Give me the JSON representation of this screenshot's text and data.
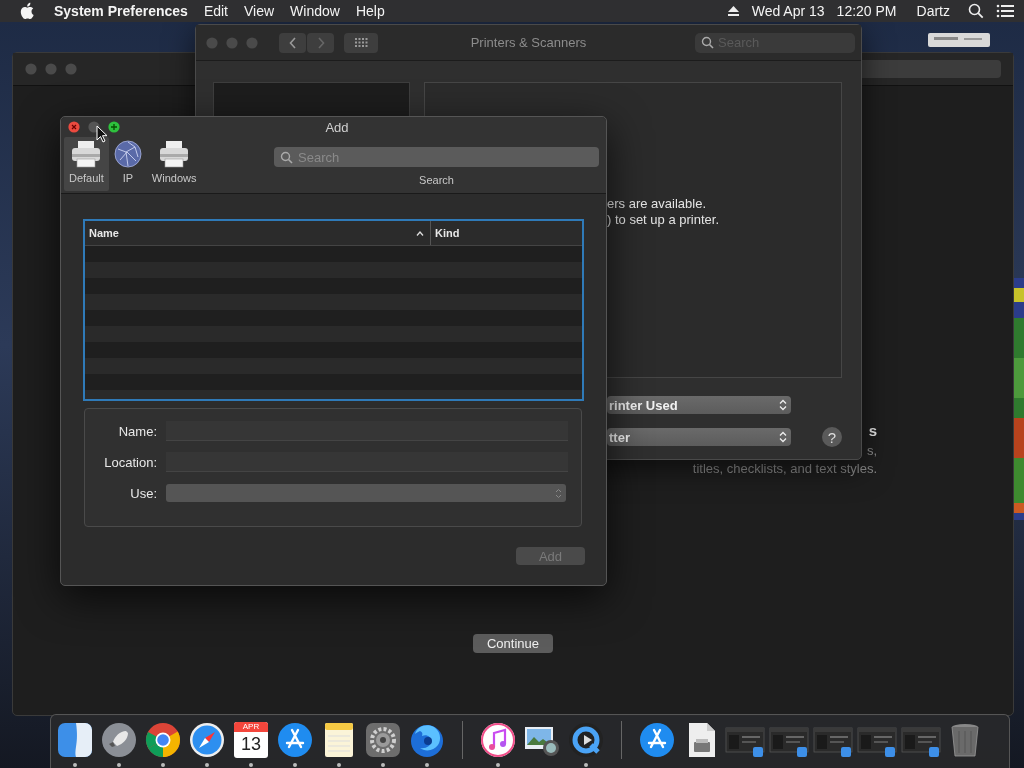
{
  "menu_bar": {
    "app_name": "System Preferences",
    "menus": [
      "Edit",
      "View",
      "Window",
      "Help"
    ],
    "date": "Wed Apr 13",
    "time": "12:20 PM",
    "user": "Dartz"
  },
  "background_window": {
    "heading": "s",
    "text_lines": [
      "s,",
      "titles, checklists, and text styles."
    ],
    "continue_button": "Continue"
  },
  "printers_window": {
    "title": "Printers & Scanners",
    "search": {
      "placeholder": "Search"
    },
    "message_lines": [
      "ers are available.",
      ") to set up a printer."
    ],
    "popups": [
      {
        "value": "rinter Used"
      },
      {
        "value": "tter"
      }
    ],
    "help_button": "?"
  },
  "add_dialog": {
    "title": "Add",
    "toolbar": [
      {
        "label": "Default",
        "selected": true
      },
      {
        "label": "IP",
        "selected": false
      },
      {
        "label": "Windows",
        "selected": false
      }
    ],
    "search": {
      "placeholder": "Search",
      "label": "Search"
    },
    "table": {
      "focused": true,
      "columns": [
        {
          "label": "Name",
          "sorted": true
        },
        {
          "label": "Kind",
          "sorted": false
        }
      ]
    },
    "form": [
      {
        "label": "Name:",
        "kind": "text"
      },
      {
        "label": "Location:",
        "kind": "text"
      },
      {
        "label": "Use:",
        "kind": "popup"
      }
    ],
    "add_button": {
      "label": "Add",
      "disabled": true
    }
  },
  "dock": {
    "items": [
      {
        "kind": "app",
        "running": true
      },
      {
        "kind": "app",
        "running": true
      },
      {
        "kind": "app",
        "running": true
      },
      {
        "kind": "app",
        "running": true
      },
      {
        "kind": "calendar",
        "month": "APR",
        "day": "13",
        "running": true
      },
      {
        "kind": "app",
        "running": true
      },
      {
        "kind": "app",
        "running": true
      },
      {
        "kind": "app",
        "running": true
      },
      {
        "kind": "app",
        "running": true
      },
      {
        "kind": "separator"
      },
      {
        "kind": "app",
        "running": true
      },
      {
        "kind": "app",
        "running": false
      },
      {
        "kind": "app",
        "running": true
      },
      {
        "kind": "separator"
      },
      {
        "kind": "app",
        "running": false
      },
      {
        "kind": "app",
        "running": false
      },
      {
        "kind": "window",
        "running": false
      },
      {
        "kind": "window",
        "running": false
      },
      {
        "kind": "window",
        "running": false
      },
      {
        "kind": "window",
        "running": false
      },
      {
        "kind": "window",
        "running": false
      },
      {
        "kind": "trash",
        "running": false
      }
    ]
  }
}
